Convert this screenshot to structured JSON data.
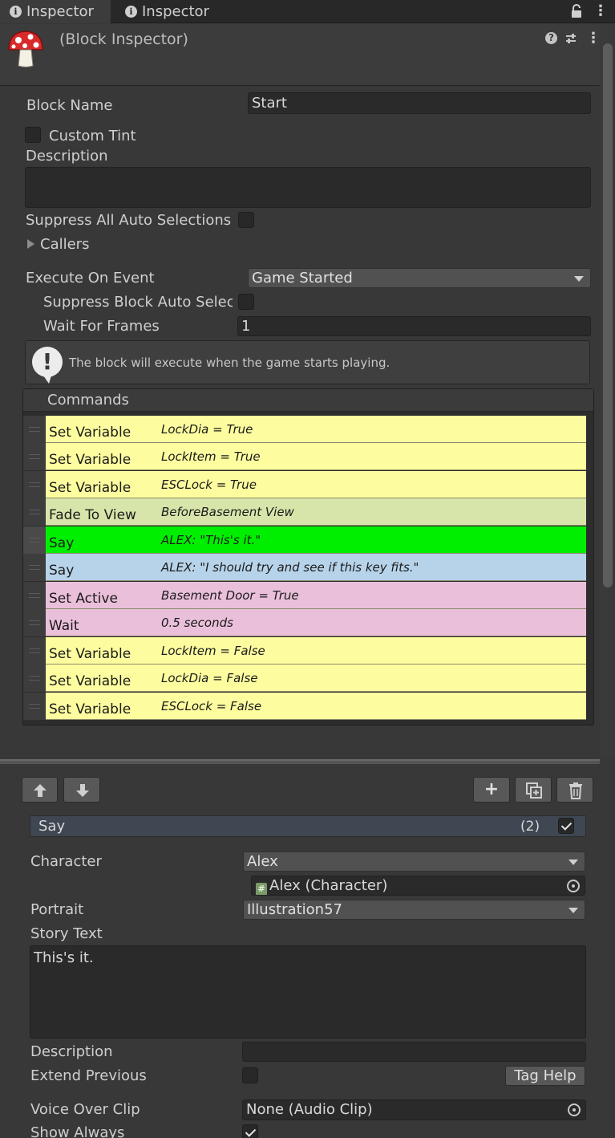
{
  "tabs": [
    {
      "label": "Inspector",
      "active": true
    },
    {
      "label": "Inspector",
      "active": false
    }
  ],
  "header": {
    "title": "(Block Inspector)",
    "icon": "mushroom-icon"
  },
  "block": {
    "name_label": "Block Name",
    "name_value": "Start",
    "custom_tint_label": "Custom Tint",
    "description_label": "Description",
    "description_value": "",
    "suppress_all_label": "Suppress All Auto Selections",
    "callers_label": "Callers",
    "execute_label": "Execute On Event",
    "execute_value": "Game Started",
    "suppress_block_label": "Suppress Block Auto Selec",
    "wait_frames_label": "Wait For Frames",
    "wait_frames_value": "1",
    "help_text": "The block will execute when the game starts playing."
  },
  "commands": {
    "header": "Commands",
    "rows": [
      {
        "name": "Set Variable",
        "summary": "LockDia = True",
        "color": "#fdfd9f"
      },
      {
        "name": "Set Variable",
        "summary": "LockItem = True",
        "color": "#fdfd9f"
      },
      {
        "name": "Set Variable",
        "summary": "ESCLock = True",
        "color": "#fdfd9f"
      },
      {
        "name": "Fade To View",
        "summary": "BeforeBasement View",
        "color": "#d7e5aa"
      },
      {
        "name": "Say",
        "summary": "ALEX: \"This's it.\"",
        "color": "#00ef00"
      },
      {
        "name": "Say",
        "summary": "ALEX: \"I should try and see if this key fits.\"",
        "color": "#b7d3ea"
      },
      {
        "name": "Set Active",
        "summary": "Basement Door = True",
        "color": "#eabfda"
      },
      {
        "name": "Wait",
        "summary": "0.5 seconds",
        "color": "#eabfda"
      },
      {
        "name": "Set Variable",
        "summary": "LockItem = False",
        "color": "#fdfd9f"
      },
      {
        "name": "Set Variable",
        "summary": "LockDia = False",
        "color": "#fdfd9f"
      },
      {
        "name": "Set Variable",
        "summary": "ESCLock = False",
        "color": "#fdfd9f"
      }
    ]
  },
  "toolbar": {
    "up_icon": "arrow-up-icon",
    "down_icon": "arrow-down-icon",
    "add_label": "+",
    "duplicate_icon": "duplicate-icon",
    "delete_icon": "trash-icon"
  },
  "say": {
    "title": "Say",
    "index": "(2)",
    "character_label": "Character",
    "character_value": "Alex",
    "character_object": "Alex (Character)",
    "portrait_label": "Portrait",
    "portrait_value": "Illustration57",
    "story_label": "Story Text",
    "story_value": "This's it.",
    "description_label": "Description",
    "description_value": "",
    "extend_label": "Extend Previous",
    "tag_help_label": "Tag Help",
    "voice_label": "Voice Over Clip",
    "voice_value": "None (Audio Clip)",
    "show_always_label": "Show Always"
  }
}
